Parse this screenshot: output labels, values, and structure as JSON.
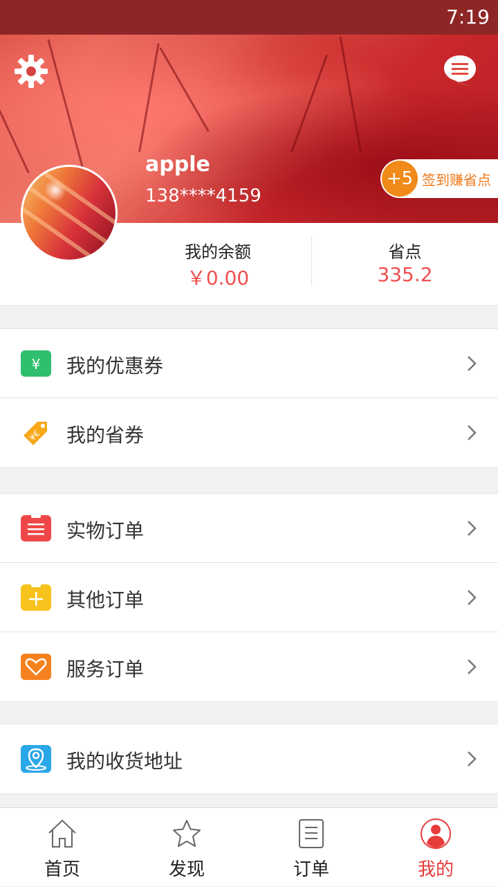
{
  "status_bar": {
    "time": "7:19"
  },
  "profile": {
    "username": "apple",
    "phone": "138****4159",
    "checkin_badge": "+5",
    "checkin_label": "签到赚省点"
  },
  "account": {
    "balance_label": "我的余额",
    "balance_value": "￥0.00",
    "points_label": "省点",
    "points_value": "335.2"
  },
  "menu": {
    "group1": [
      {
        "label": "我的优惠券",
        "icon": "yuan-coupon-icon",
        "color": "#2fbf6e"
      },
      {
        "label": "我的省券",
        "icon": "tag-ticket-icon",
        "color": "#f7a81b"
      }
    ],
    "group2": [
      {
        "label": "实物订单",
        "icon": "clipboard-list-icon",
        "color": "#ef4747"
      },
      {
        "label": "其他订单",
        "icon": "clipboard-plus-icon",
        "color": "#f8c31c"
      },
      {
        "label": "服务订单",
        "icon": "heart-icon",
        "color": "#f5821f"
      }
    ],
    "group3": [
      {
        "label": "我的收货地址",
        "icon": "location-pin-icon",
        "color": "#2aa7e8"
      }
    ]
  },
  "tabbar": [
    {
      "label": "首页",
      "icon": "home-icon",
      "active": false
    },
    {
      "label": "发现",
      "icon": "star-icon",
      "active": false
    },
    {
      "label": "订单",
      "icon": "document-icon",
      "active": false
    },
    {
      "label": "我的",
      "icon": "user-icon",
      "active": true
    }
  ],
  "colors": {
    "accent": "#ef4f4f",
    "status_bar": "#8e2626",
    "active_tab": "#e63b3b"
  }
}
